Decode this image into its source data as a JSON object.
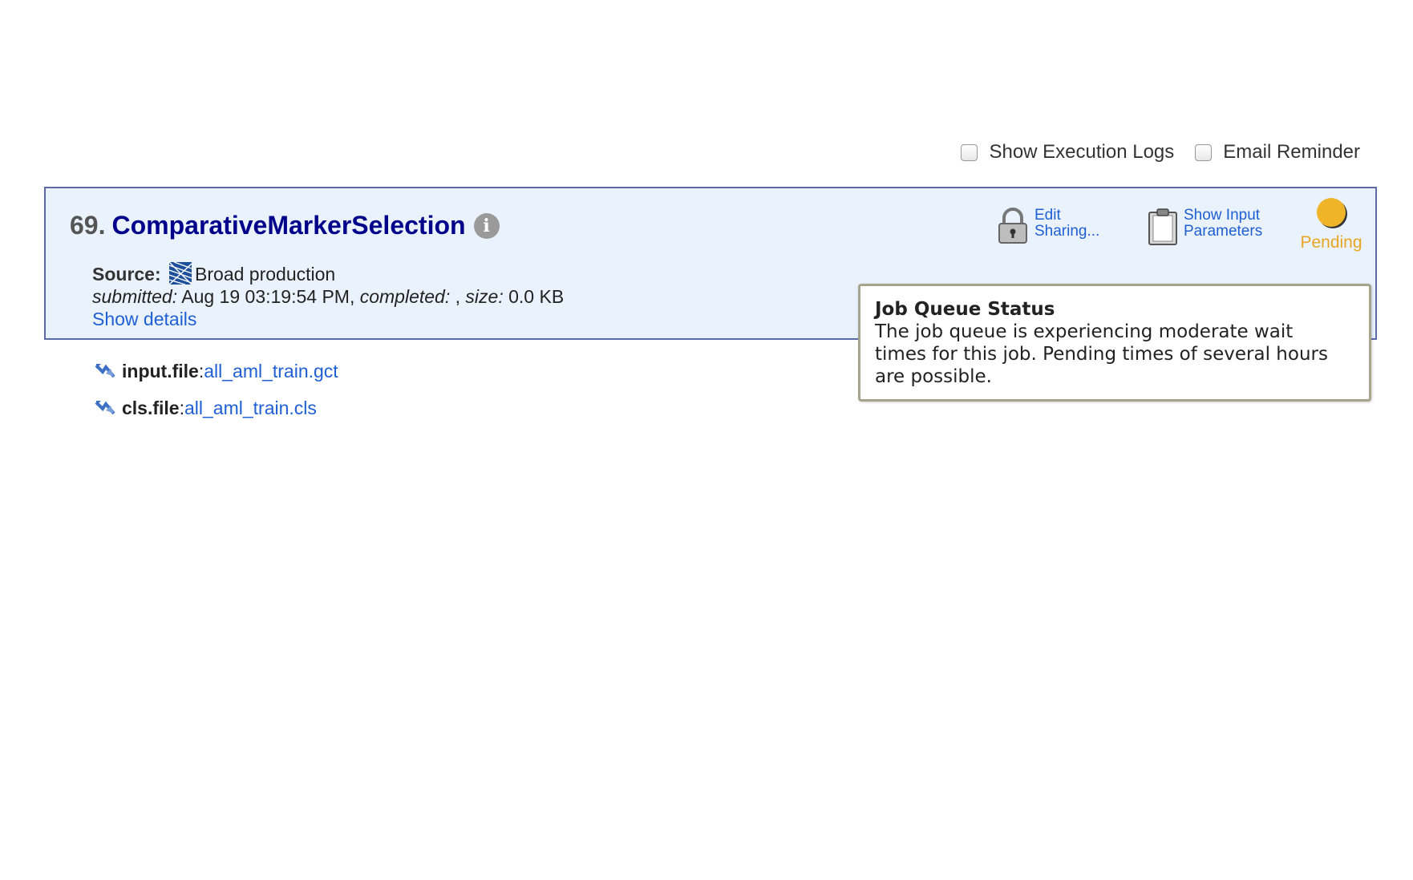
{
  "options": {
    "show_execution_logs": "Show Execution Logs",
    "email_reminder": "Email Reminder"
  },
  "job": {
    "number": "69.",
    "name": "ComparativeMarkerSelection",
    "source_label": "Source:",
    "source_value": "Broad production",
    "submitted_label": "submitted:",
    "submitted_value": "Aug 19 03:19:54 PM,",
    "completed_label": "completed:",
    "completed_value": ",",
    "size_label": "size:",
    "size_value": "0.0 KB",
    "show_details": "Show details"
  },
  "actions": {
    "edit_sharing_line1": "Edit",
    "edit_sharing_line2": "Sharing...",
    "show_input_line1": "Show Input",
    "show_input_line2": "Parameters"
  },
  "status": {
    "label": "Pending",
    "color": "#f0b429"
  },
  "parameters": [
    {
      "name": "input.file",
      "value": "all_aml_train.gct"
    },
    {
      "name": "cls.file",
      "value": "all_aml_train.cls"
    }
  ],
  "tooltip": {
    "title": "Job Queue Status",
    "line1": "The job queue is experiencing moderate wait",
    "line2": "times for this job. Pending times of several hours",
    "line3": "are possible."
  }
}
